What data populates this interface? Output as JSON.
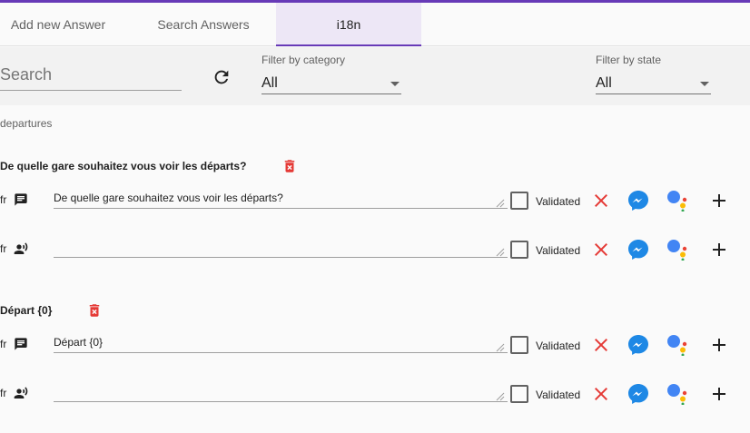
{
  "tabs": [
    {
      "label": "Add new Answer"
    },
    {
      "label": "Search Answers"
    },
    {
      "label": "i18n",
      "active": true
    }
  ],
  "filters": {
    "search_placeholder": "Search",
    "category_label": "Filter by category",
    "category_value": "All",
    "state_label": "Filter by state",
    "state_value": "All"
  },
  "category": "departures",
  "entries": [
    {
      "key": "De quelle gare souhaitez vous voir les départs?",
      "rows": [
        {
          "lang": "fr",
          "type": "text",
          "value": "De quelle gare souhaitez vous voir les départs?",
          "validated_label": "Validated"
        },
        {
          "lang": "fr",
          "type": "voice",
          "value": "",
          "validated_label": "Validated"
        }
      ]
    },
    {
      "key": "Départ {0}",
      "rows": [
        {
          "lang": "fr",
          "type": "text",
          "value": "Départ {0}",
          "validated_label": "Validated"
        },
        {
          "lang": "fr",
          "type": "voice",
          "value": "",
          "validated_label": "Validated"
        }
      ]
    }
  ],
  "colors": {
    "accent": "#673ab7",
    "delete": "#e53935",
    "messenger": "#1e88e5",
    "google_blue": "#4285f4",
    "google_red": "#ea4335",
    "google_yellow": "#fbbc05",
    "google_green": "#34a853"
  }
}
